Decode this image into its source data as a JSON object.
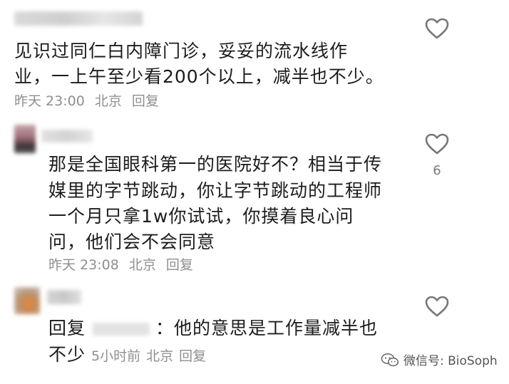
{
  "comments": [
    {
      "text_lines": [
        "见识过同仁白内障门诊，妥妥的流水线作",
        "业，一上午至少看200个以上，减半也不少。"
      ],
      "time": "昨天 23:00",
      "location": "北京",
      "reply_label": "回复",
      "like_icon": "heart-outline-icon",
      "like_count": ""
    },
    {
      "text_lines": [
        "那是全国眼科第一的医院好不？相当于传",
        "媒里的字节跳动，你让字节跳动的工程师",
        "一个月只拿1w你试试，你摸着良心问",
        "问，他们会不会同意"
      ],
      "time": "昨天 23:08",
      "location": "北京",
      "reply_label": "回复",
      "like_icon": "heart-outline-icon",
      "like_count": "6"
    },
    {
      "reply_prefix": "回复",
      "reply_suffix": "：他的意思是工作量减半也",
      "line2": "不少",
      "time": "5小时前",
      "location": "北京",
      "reply_label": "回复",
      "like_icon": "heart-outline-icon",
      "like_count": ""
    }
  ],
  "watermark": {
    "icon": "wechat-icon",
    "text": "微信号: BioSoph"
  },
  "colors": {
    "text": "#1c1c1c",
    "meta": "#8f8f8f",
    "icon": "#777777"
  }
}
